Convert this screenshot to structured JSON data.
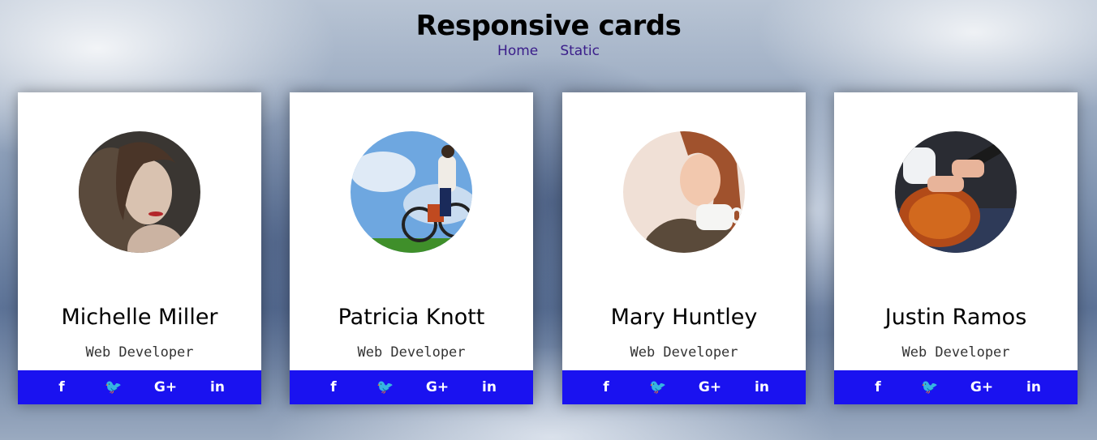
{
  "header": {
    "title": "Responsive cards",
    "nav": [
      {
        "label": "Home"
      },
      {
        "label": "Static"
      }
    ]
  },
  "colors": {
    "social_bar": "#1a12f0",
    "nav_link": "#3a1d8a"
  },
  "social_icons": [
    {
      "name": "facebook-icon",
      "glyph": "f"
    },
    {
      "name": "twitter-icon",
      "glyph": "🐦"
    },
    {
      "name": "google-plus-icon",
      "glyph": "G+"
    },
    {
      "name": "linkedin-icon",
      "glyph": "in"
    }
  ],
  "cards": [
    {
      "name": "Michelle Miller",
      "role": "Web Developer"
    },
    {
      "name": "Patricia Knott",
      "role": "Web Developer"
    },
    {
      "name": "Mary Huntley",
      "role": "Web Developer"
    },
    {
      "name": "Justin Ramos",
      "role": "Web Developer"
    }
  ]
}
